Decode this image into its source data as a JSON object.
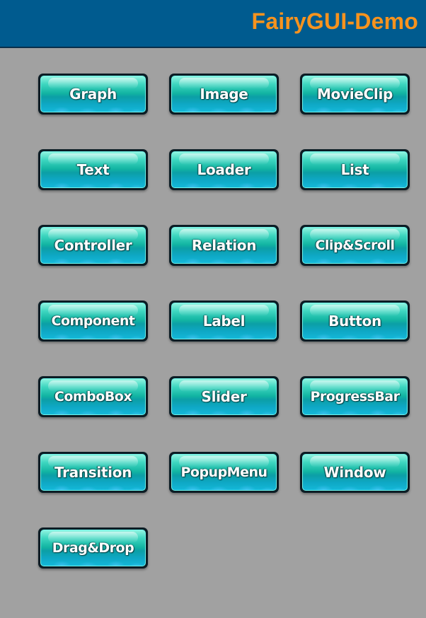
{
  "header": {
    "title": "FairyGUI-Demo",
    "background_color": "#005b8f",
    "title_color": "#f7931e"
  },
  "page": {
    "background_color": "#a1a1a1"
  },
  "demos": {
    "graph": "Graph",
    "image": "Image",
    "movieclip": "MovieClip",
    "text": "Text",
    "loader": "Loader",
    "list": "List",
    "controller": "Controller",
    "relation": "Relation",
    "clip_scroll": "Clip&Scroll",
    "component": "Component",
    "label": "Label",
    "button": "Button",
    "combobox": "ComboBox",
    "slider": "Slider",
    "progressbar": "ProgressBar",
    "transition": "Transition",
    "popupmenu": "PopupMenu",
    "window": "Window",
    "drag_drop": "Drag&Drop"
  }
}
